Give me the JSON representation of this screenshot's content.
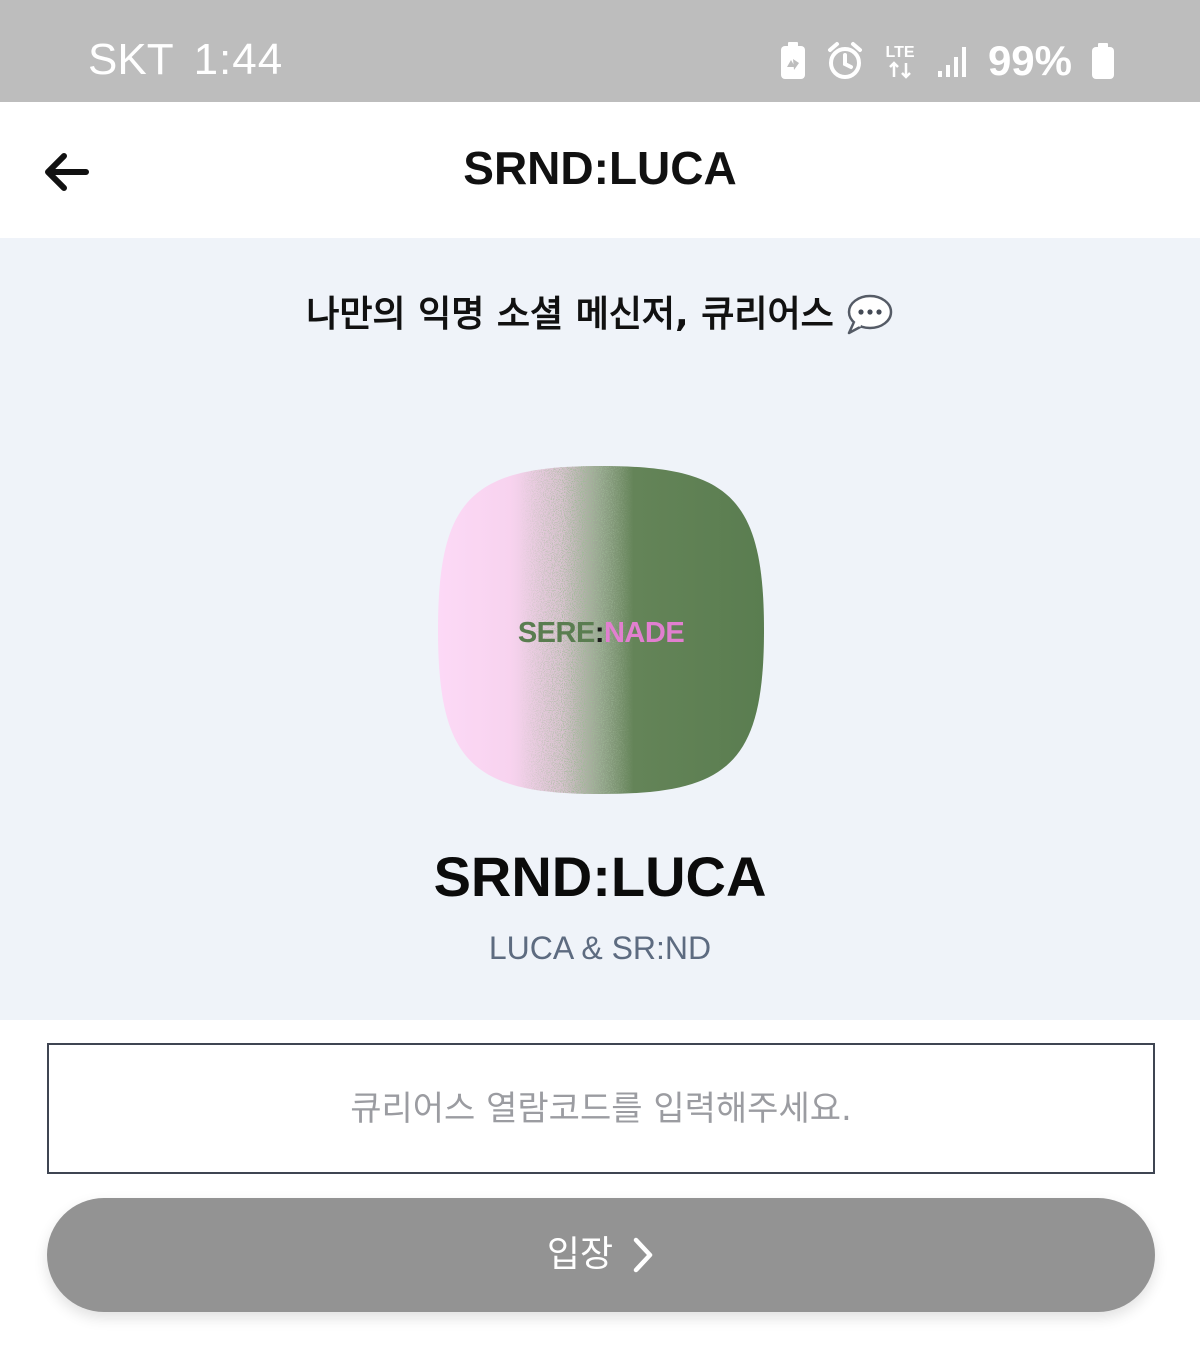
{
  "status_bar": {
    "carrier": "SKT",
    "time": "1:44",
    "network": "LTE",
    "battery_percent": "99%",
    "icons": [
      "battery-saver-icon",
      "alarm-icon",
      "lte-icon",
      "signal-icon",
      "battery-icon"
    ]
  },
  "header": {
    "title": "SRND:LUCA",
    "back_icon": "back-arrow-icon"
  },
  "hero": {
    "tagline": "나만의 익명 소셜 메신저, 큐리어스",
    "tagline_icon": "chat-bubble-icon",
    "logo": {
      "text_left": "SERE",
      "separator": ":",
      "text_right": "NADE",
      "color_left": "#5a7d50",
      "color_right": "#e27fd0"
    },
    "app_name": "SRND:LUCA",
    "author": "LUCA & SR:ND"
  },
  "form": {
    "code_placeholder": "큐리어스 열람코드를 입력해주세요.",
    "code_value": "",
    "enter_label": "입장",
    "enter_icon": "chevron-right-icon"
  },
  "colors": {
    "status_bar_bg": "#bdbdbd",
    "hero_bg": "#eff3f9",
    "button_bg": "#939393",
    "icon_pink": "#fbd9f5",
    "icon_green": "#5a7d50"
  }
}
